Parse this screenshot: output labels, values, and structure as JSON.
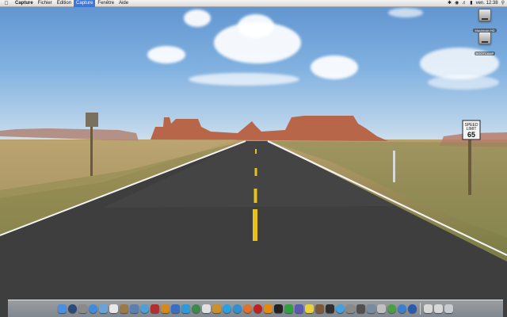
{
  "menubar": {
    "app_name": "Capture",
    "items": [
      "Fichier",
      "Édition",
      "Capture",
      "Fenêtre",
      "Aide"
    ],
    "active_item": "Capture",
    "clock": "ven. 12:38",
    "status_icons": [
      "bluetooth-icon",
      "wifi-icon",
      "volume-icon",
      "battery-icon",
      "spotlight-icon"
    ]
  },
  "desktop": {
    "icons": [
      {
        "label": "Macintosh HD",
        "icon": "hard-drive-icon"
      },
      {
        "label": "BOOTCAMP",
        "icon": "hard-drive-icon"
      }
    ],
    "wallpaper": "desert-road-monument-valley",
    "sign_text": [
      "SPEED",
      "LIMIT",
      "65"
    ]
  },
  "dock": {
    "apps": [
      {
        "name": "finder",
        "color": "#4a8fe0"
      },
      {
        "name": "dashboard",
        "color": "#2a4a7a"
      },
      {
        "name": "system-preferences",
        "color": "#8a8a8a"
      },
      {
        "name": "safari",
        "color": "#3e8ce0"
      },
      {
        "name": "mail",
        "color": "#6aa3d8"
      },
      {
        "name": "ical",
        "color": "#e8e8e8"
      },
      {
        "name": "address-book",
        "color": "#9b7a4a"
      },
      {
        "name": "iphoto",
        "color": "#5a7fb0"
      },
      {
        "name": "itunes",
        "color": "#4aa0d8"
      },
      {
        "name": "photo-booth",
        "color": "#b03030"
      },
      {
        "name": "garageband",
        "color": "#d08a20"
      },
      {
        "name": "imovie",
        "color": "#3a6fc0"
      },
      {
        "name": "iweb",
        "color": "#2f9ad8"
      },
      {
        "name": "time-machine",
        "color": "#3a8a4a"
      },
      {
        "name": "textedit",
        "color": "#e0e0e0"
      },
      {
        "name": "preview",
        "color": "#c89030"
      },
      {
        "name": "skype",
        "color": "#2aa0e0"
      },
      {
        "name": "network",
        "color": "#3090d0"
      },
      {
        "name": "firefox",
        "color": "#e0702a"
      },
      {
        "name": "opera",
        "color": "#c02020"
      },
      {
        "name": "vlc",
        "color": "#e08a10"
      },
      {
        "name": "terminal",
        "color": "#222222"
      },
      {
        "name": "activity-monitor",
        "color": "#30a040"
      },
      {
        "name": "grapher",
        "color": "#5a5ab0"
      },
      {
        "name": "stickies",
        "color": "#e8d040"
      },
      {
        "name": "chess",
        "color": "#7a5a3a"
      },
      {
        "name": "dvd-player",
        "color": "#303030"
      },
      {
        "name": "ichat",
        "color": "#40a0e0"
      },
      {
        "name": "utilities",
        "color": "#8a8a8a"
      },
      {
        "name": "calculator",
        "color": "#505050"
      },
      {
        "name": "disk-utility",
        "color": "#7a8aa0"
      },
      {
        "name": "capture",
        "color": "#c0c0c0"
      },
      {
        "name": "chrome",
        "color": "#4aa040"
      },
      {
        "name": "app-store",
        "color": "#3a80d0"
      },
      {
        "name": "quicktime",
        "color": "#2a5ab0"
      }
    ],
    "right": [
      {
        "name": "documents-stack",
        "color": "#d8d8d8"
      },
      {
        "name": "downloads-stack",
        "color": "#d8d8d8"
      },
      {
        "name": "trash",
        "color": "#c8ccd0"
      }
    ]
  }
}
